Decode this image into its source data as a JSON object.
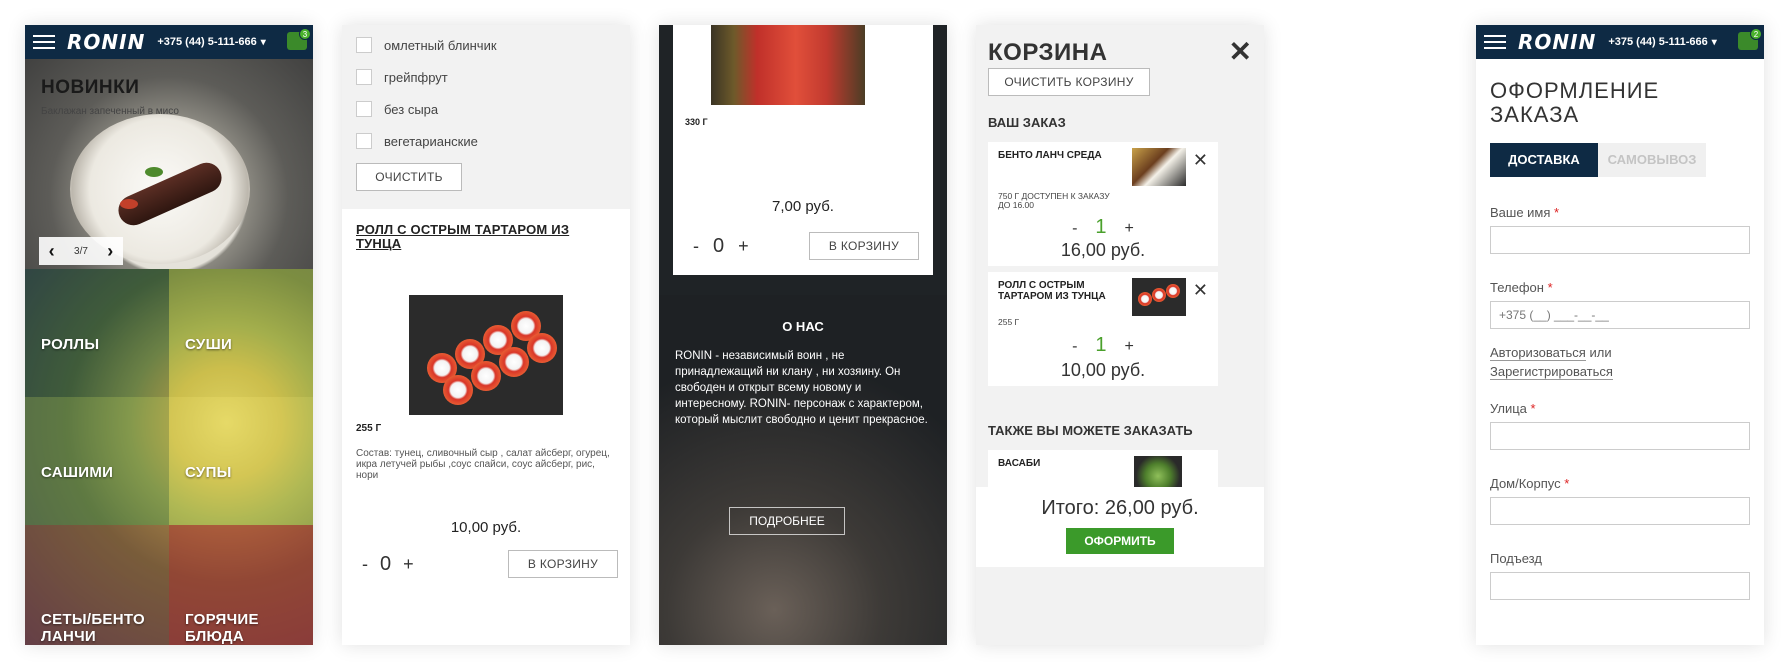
{
  "header": {
    "logo": "RONIN",
    "phone": "+375 (44) 5-111-666",
    "chevron": "⌄"
  },
  "panel1": {
    "cart_count": "3",
    "hero_title": "НОВИНКИ",
    "hero_subtitle": "Баклажан запеченный в мисо",
    "slider": {
      "prev": "‹",
      "counter": "3/7",
      "next": "›"
    },
    "categories": [
      "РОЛЛЫ",
      "СУШИ",
      "САШИМИ",
      "СУПЫ",
      "СЕТЫ/БЕНТО ЛАНЧИ",
      "ГОРЯЧИЕ БЛЮДА"
    ]
  },
  "panel2": {
    "filters": [
      "омлетный блинчик",
      "грейпфрут",
      "без сыра",
      "вегетарианские"
    ],
    "clear_label": "ОЧИСТИТЬ",
    "product_title": "РОЛЛ С ОСТРЫМ ТАРТАРОМ ИЗ ТУНЦА",
    "weight": "255 Г",
    "composition": "Состав: тунец, сливочный сыр , салат айсберг, огурец, икра летучей рыбы ,соус спайси, соус айсберг, рис, нори",
    "price": "10,00 руб.",
    "qty": {
      "minus": "-",
      "value": "0",
      "plus": "+"
    },
    "to_cart": "В КОРЗИНУ"
  },
  "panel3": {
    "weight": "330 Г",
    "price": "7,00 руб.",
    "qty": {
      "minus": "-",
      "value": "0",
      "plus": "+"
    },
    "to_cart": "В КОРЗИНУ",
    "about_title": "О НАС",
    "about_text": "RONIN - независимый воин , не принадлежащий ни клану , ни хозяину. Он свободен и открыт всему новому и интересному. RONIN- персонаж с характером, который мыслит свободно и ценит прекрасное.",
    "more": "ПОДРОБНЕЕ"
  },
  "panel4": {
    "title": "КОРЗИНА",
    "close": "✕",
    "clear": "ОЧИСТИТЬ КОРЗИНУ",
    "your_order": "ВАШ ЗАКАЗ",
    "items": [
      {
        "name": "БЕНТО ЛАНЧ СРЕДА",
        "meta": "750 Г ДОСТУПЕН К ЗАКАЗУ ДО 16.00",
        "qty": "1",
        "price": "16,00 руб."
      },
      {
        "name": "РОЛЛ С ОСТРЫМ ТАРТАРОМ ИЗ ТУНЦА",
        "meta": "255 Г",
        "qty": "1",
        "price": "10,00 руб."
      }
    ],
    "minus": "-",
    "plus": "+",
    "remove": "✕",
    "also": "ТАКЖЕ ВЫ МОЖЕТЕ ЗАКАЗАТЬ",
    "suggest": "ВАСАБИ",
    "total": "Итого: 26,00 руб.",
    "order_btn": "ОФОРМИТЬ"
  },
  "panel5": {
    "cart_count": "2",
    "title": "ОФОРМЛЕНИЕ ЗАКАЗА",
    "tab_delivery": "ДОСТАВКА",
    "tab_pickup": "САМОВЫВОЗ",
    "name_label": "Ваше имя",
    "phone_label": "Телефон",
    "phone_placeholder": "+375 (__) ___-__-__",
    "auth_link": "Авторизоваться",
    "or": "или",
    "register_link": "Зарегистрироваться",
    "street_label": "Улица",
    "house_label": "Дом/Корпус",
    "entrance_label": "Подъезд",
    "required": "*"
  }
}
